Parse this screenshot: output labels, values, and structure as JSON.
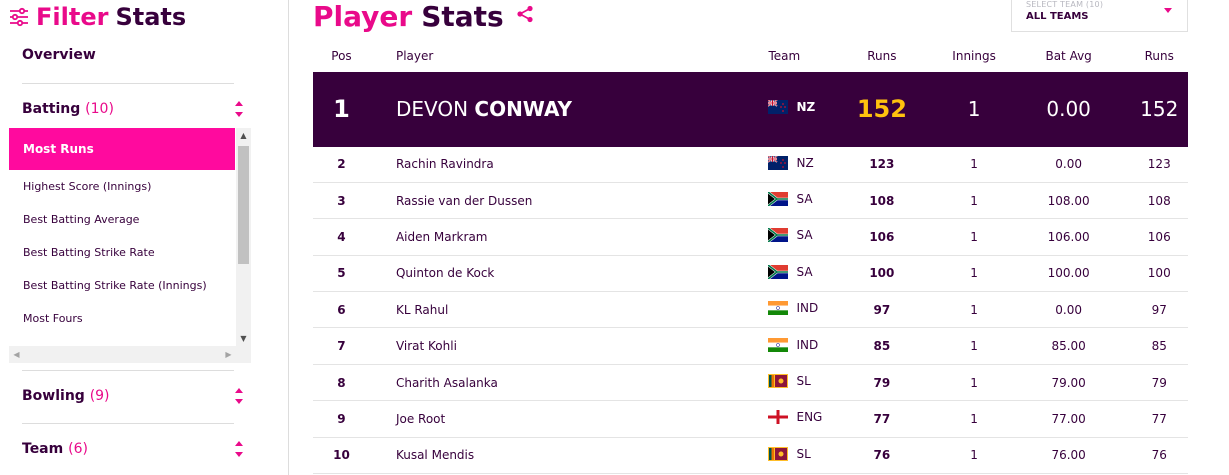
{
  "sidebar": {
    "title_part1": "Filter",
    "title_part2": "Stats",
    "overview": "Overview",
    "sections": [
      {
        "label": "Batting",
        "count": "(10)"
      },
      {
        "label": "Bowling",
        "count": "(9)"
      },
      {
        "label": "Team",
        "count": "(6)"
      }
    ],
    "batting_items": [
      "Most Runs",
      "Highest Score (Innings)",
      "Best Batting Average",
      "Best Batting Strike Rate",
      "Best Batting Strike Rate (Innings)",
      "Most Fours"
    ]
  },
  "main": {
    "title_part1": "Player",
    "title_part2": "Stats",
    "team_select": {
      "placeholder": "SELECT TEAM (10)",
      "value": "ALL TEAMS"
    },
    "columns": [
      "Pos",
      "Player",
      "Team",
      "Runs",
      "Innings",
      "Bat Avg",
      "Runs"
    ],
    "top": {
      "pos": "1",
      "first": "DEVON",
      "last": "CONWAY",
      "team": "NZ",
      "flag": "nz",
      "runs": "152",
      "innings": "1",
      "avg": "0.00",
      "runs2": "152"
    },
    "rows": [
      {
        "pos": "2",
        "player": "Rachin Ravindra",
        "team": "NZ",
        "flag": "nz",
        "runs": "123",
        "innings": "1",
        "avg": "0.00",
        "runs2": "123"
      },
      {
        "pos": "3",
        "player": "Rassie van der Dussen",
        "team": "SA",
        "flag": "sa",
        "runs": "108",
        "innings": "1",
        "avg": "108.00",
        "runs2": "108"
      },
      {
        "pos": "4",
        "player": "Aiden Markram",
        "team": "SA",
        "flag": "sa",
        "runs": "106",
        "innings": "1",
        "avg": "106.00",
        "runs2": "106"
      },
      {
        "pos": "5",
        "player": "Quinton de Kock",
        "team": "SA",
        "flag": "sa",
        "runs": "100",
        "innings": "1",
        "avg": "100.00",
        "runs2": "100"
      },
      {
        "pos": "6",
        "player": "KL Rahul",
        "team": "IND",
        "flag": "ind",
        "runs": "97",
        "innings": "1",
        "avg": "0.00",
        "runs2": "97"
      },
      {
        "pos": "7",
        "player": "Virat Kohli",
        "team": "IND",
        "flag": "ind",
        "runs": "85",
        "innings": "1",
        "avg": "85.00",
        "runs2": "85"
      },
      {
        "pos": "8",
        "player": "Charith Asalanka",
        "team": "SL",
        "flag": "sl",
        "runs": "79",
        "innings": "1",
        "avg": "79.00",
        "runs2": "79"
      },
      {
        "pos": "9",
        "player": "Joe Root",
        "team": "ENG",
        "flag": "eng",
        "runs": "77",
        "innings": "1",
        "avg": "77.00",
        "runs2": "77"
      },
      {
        "pos": "10",
        "player": "Kusal Mendis",
        "team": "SL",
        "flag": "sl",
        "runs": "76",
        "innings": "1",
        "avg": "76.00",
        "runs2": "76"
      }
    ]
  },
  "colors": {
    "accent": "#e90a8a",
    "brand": "#37003c",
    "highlight": "#ffc20e",
    "active_item": "#ff0a9e"
  }
}
